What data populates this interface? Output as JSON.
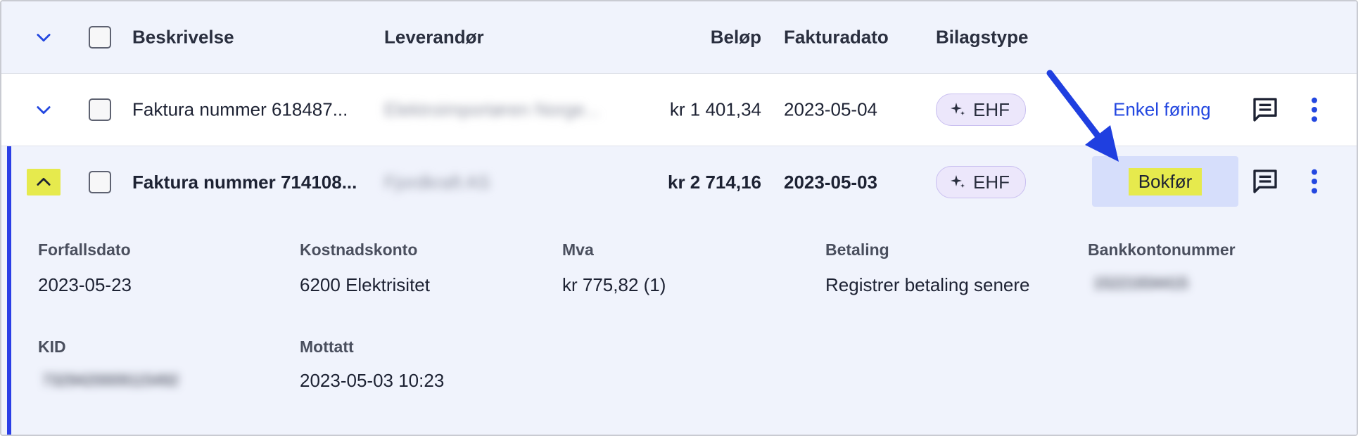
{
  "header": {
    "col_description": "Beskrivelse",
    "col_vendor": "Leverandør",
    "col_amount": "Beløp",
    "col_invoice_date": "Fakturadato",
    "col_doc_type": "Bilagstype"
  },
  "rows": [
    {
      "description": "Faktura nummer 618487...",
      "vendor": "Elektroimportøren Norge...",
      "amount": "kr 1 401,34",
      "invoice_date": "2023-05-04",
      "doc_type": "EHF",
      "action": "Enkel føring",
      "expanded": false
    },
    {
      "description": "Faktura nummer 714108...",
      "vendor": "Fjordkraft AS",
      "amount": "kr 2 714,16",
      "invoice_date": "2023-05-03",
      "doc_type": "EHF",
      "action": "Bokfør",
      "expanded": true
    }
  ],
  "details": {
    "due_date_label": "Forfallsdato",
    "due_date": "2023-05-23",
    "cost_account_label": "Kostnadskonto",
    "cost_account": "6200 Elektrisitet",
    "vat_label": "Mva",
    "vat": "kr 775,82 (1)",
    "payment_label": "Betaling",
    "payment": "Registrer betaling senere",
    "bank_account_label": "Bankkontonummer",
    "bank_account": "15221934415",
    "kid_label": "KID",
    "kid": "7329420009115492",
    "received_label": "Mottatt",
    "received": "2023-05-03 10:23"
  },
  "icons": {
    "expand": "chevron-down-icon",
    "collapse": "chevron-up-icon",
    "sparkle": "sparkle-icon",
    "comment": "comment-icon",
    "more": "more-vertical-icon"
  },
  "colors": {
    "accent": "#2a3ee6",
    "link": "#2347e0",
    "highlight": "#e6ea4d",
    "header_bg": "#f0f3fc",
    "badge_bg": "#ece7fb"
  }
}
